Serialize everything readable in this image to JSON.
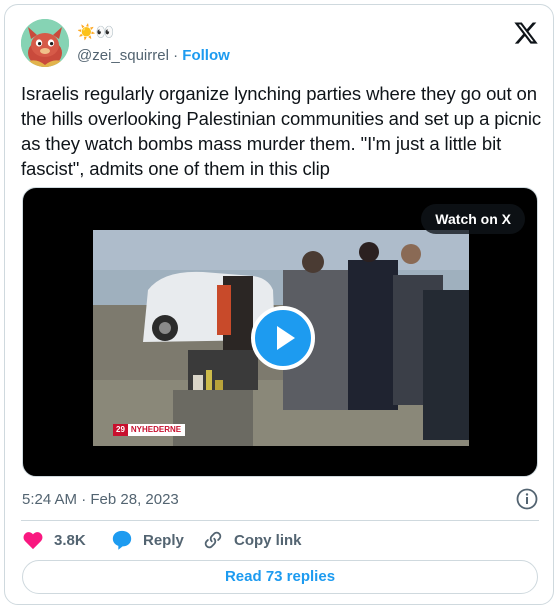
{
  "author": {
    "display_name_emoji": "☀️👀",
    "handle": "@zei_squirrel",
    "separator": "·",
    "follow_label": "Follow"
  },
  "tweet": {
    "text": "Israelis regularly organize lynching parties where they go out on the hills overlooking Palestinian communities and set up a picnic as they watch bombs mass murder them. \"I'm just a little bit fascist\", admits one of them in this clip",
    "timestamp": "5:24 AM · Feb 28, 2023"
  },
  "media": {
    "watch_label": "Watch on X",
    "broadcast_number": "29",
    "broadcast_label": "NYHEDERNE"
  },
  "actions": {
    "like_count": "3.8K",
    "reply_label": "Reply",
    "copy_link_label": "Copy link",
    "read_replies_label": "Read 73 replies"
  },
  "colors": {
    "accent": "#1d9bf0",
    "like": "#f91880",
    "text": "#0f1419",
    "muted": "#536471",
    "border": "#cfd9de"
  },
  "icons": [
    "avatar-dragon",
    "x-logo-icon",
    "play-icon",
    "info-icon",
    "heart-icon",
    "reply-bubble-icon",
    "link-icon"
  ]
}
